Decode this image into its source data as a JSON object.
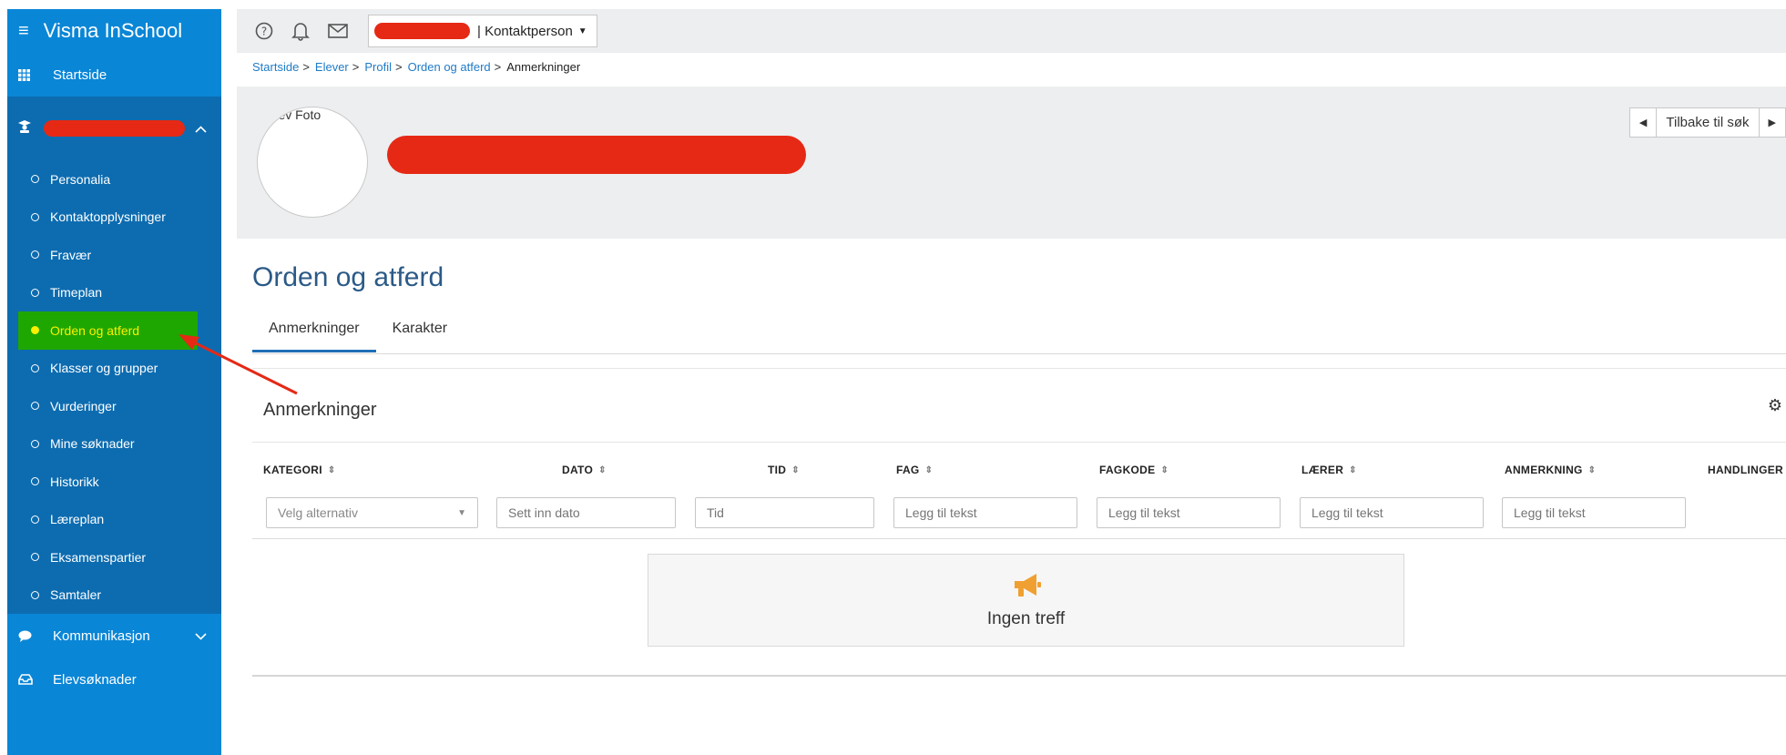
{
  "app": {
    "title": "Visma InSchool"
  },
  "sidebar": {
    "home_label": "Startside",
    "student_submenu": [
      {
        "label": "Personalia",
        "active": false
      },
      {
        "label": "Kontaktopplysninger",
        "active": false
      },
      {
        "label": "Fravær",
        "active": false
      },
      {
        "label": "Timeplan",
        "active": false
      },
      {
        "label": "Orden og atferd",
        "active": true
      },
      {
        "label": "Klasser og grupper",
        "active": false
      },
      {
        "label": "Vurderinger",
        "active": false
      },
      {
        "label": "Mine søknader",
        "active": false
      },
      {
        "label": "Historikk",
        "active": false
      },
      {
        "label": "Læreplan",
        "active": false
      },
      {
        "label": "Eksamenspartier",
        "active": false
      },
      {
        "label": "Samtaler",
        "active": false
      }
    ],
    "communication_label": "Kommunikasjon",
    "applications_label": "Elevsøknader"
  },
  "topbar": {
    "role_label": "| Kontaktperson"
  },
  "breadcrumb": {
    "items": [
      "Startside",
      "Elever",
      "Profil",
      "Orden og atferd"
    ],
    "current": "Anmerkninger"
  },
  "profile": {
    "photo_label": "Elev Foto",
    "back_label": "Tilbake til søk"
  },
  "page": {
    "title": "Orden og atferd",
    "tabs": [
      {
        "label": "Anmerkninger",
        "active": true
      },
      {
        "label": "Karakter",
        "active": false
      }
    ]
  },
  "panel": {
    "title": "Anmerkninger",
    "columns": [
      "KATEGORI",
      "DATO",
      "TID",
      "FAG",
      "FAGKODE",
      "LÆRER",
      "ANMERKNING",
      "HANDLINGER"
    ],
    "filters": {
      "category_placeholder": "Velg alternativ",
      "date_placeholder": "Sett inn dato",
      "time_placeholder": "Tid",
      "text_placeholder": "Legg til tekst"
    },
    "empty_text": "Ingen treff"
  },
  "colors": {
    "sidebar": "#0a86d6",
    "sidebar_section": "#0d6cb0",
    "highlight": "#1ea700",
    "highlight_text": "#fbf000",
    "redaction": "#e52915",
    "title": "#2b5a87",
    "link": "#1f7bc7",
    "empty_icon": "#f0a030"
  }
}
